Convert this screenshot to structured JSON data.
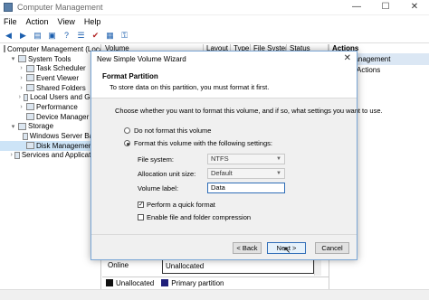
{
  "window": {
    "title": "Computer Management",
    "controls": [
      "—",
      "☐",
      "✕"
    ]
  },
  "menu": [
    "File",
    "Action",
    "View",
    "Help"
  ],
  "tree": [
    {
      "label": "Computer Management (Local)",
      "indent": 0,
      "exp": ""
    },
    {
      "label": "System Tools",
      "indent": 1,
      "exp": "▾"
    },
    {
      "label": "Task Scheduler",
      "indent": 2,
      "exp": "›"
    },
    {
      "label": "Event Viewer",
      "indent": 2,
      "exp": "›"
    },
    {
      "label": "Shared Folders",
      "indent": 2,
      "exp": "›"
    },
    {
      "label": "Local Users and Grou",
      "indent": 2,
      "exp": "›"
    },
    {
      "label": "Performance",
      "indent": 2,
      "exp": "›"
    },
    {
      "label": "Device Manager",
      "indent": 2,
      "exp": ""
    },
    {
      "label": "Storage",
      "indent": 1,
      "exp": "▾"
    },
    {
      "label": "Windows Server Back",
      "indent": 2,
      "exp": ""
    },
    {
      "label": "Disk Management",
      "indent": 2,
      "exp": "",
      "selected": true
    },
    {
      "label": "Services and Application",
      "indent": 1,
      "exp": "›"
    }
  ],
  "volume_columns": [
    "Volume",
    "Layout",
    "Type",
    "File System",
    "Status"
  ],
  "actions": {
    "header": "Actions",
    "section": "Disk Management",
    "item": "More Actions"
  },
  "diskmap": {
    "status": "Online",
    "partition": "Unallocated"
  },
  "legend": [
    {
      "label": "Unallocated",
      "color": "#111111"
    },
    {
      "label": "Primary partition",
      "color": "#1f1f7a"
    }
  ],
  "dialog": {
    "title": "New Simple Volume Wizard",
    "close": "✕",
    "heading": "Format Partition",
    "subheading": "To store data on this partition, you must format it first.",
    "intro": "Choose whether you want to format this volume, and if so, what settings you want to use.",
    "option_no_format": "Do not format this volume",
    "option_format": "Format this volume with the following settings:",
    "file_system_label": "File system:",
    "file_system_value": "NTFS",
    "unit_size_label": "Allocation unit size:",
    "unit_size_value": "Default",
    "volume_label_label": "Volume label:",
    "volume_label_value": "Data",
    "quick_format": "Perform a quick format",
    "compression": "Enable file and folder compression",
    "back": "< Back",
    "next": "Next >",
    "cancel": "Cancel"
  }
}
